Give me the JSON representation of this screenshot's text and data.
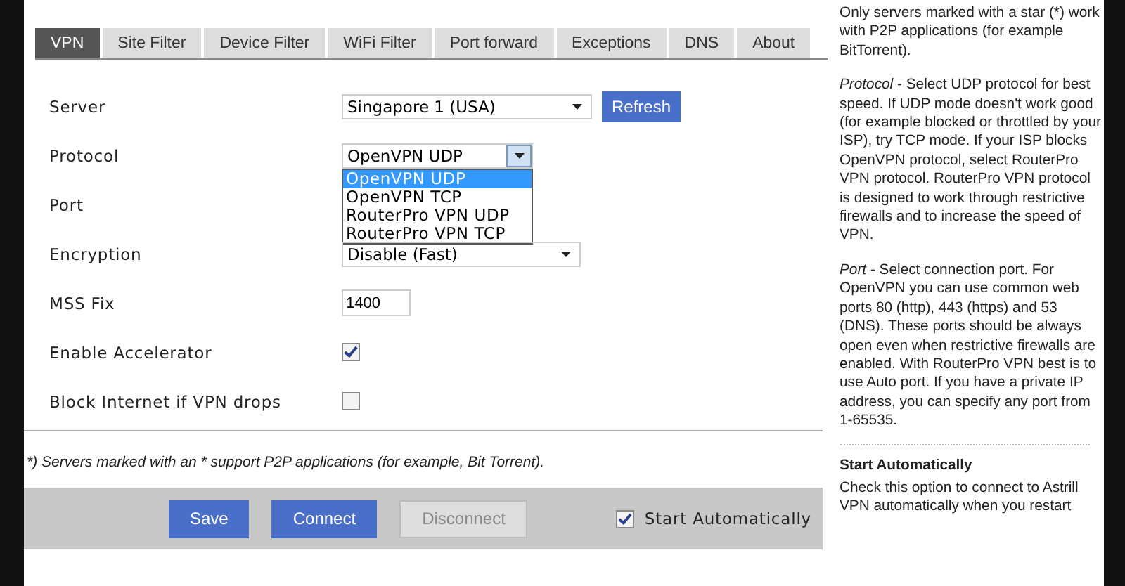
{
  "tabs": [
    {
      "label": "VPN",
      "selected": true
    },
    {
      "label": "Site Filter",
      "selected": false
    },
    {
      "label": "Device Filter",
      "selected": false
    },
    {
      "label": "WiFi Filter",
      "selected": false
    },
    {
      "label": "Port forward",
      "selected": false
    },
    {
      "label": "Exceptions",
      "selected": false
    },
    {
      "label": "DNS",
      "selected": false
    },
    {
      "label": "About",
      "selected": false
    }
  ],
  "form": {
    "rows": [
      {
        "label": "Server",
        "kind": "select",
        "value": "Singapore 1 (USA)",
        "button": "Refresh"
      },
      {
        "label": "Protocol",
        "kind": "select",
        "value": "OpenVPN UDP",
        "expanded": true,
        "options": [
          {
            "label": "OpenVPN UDP",
            "selected": true
          },
          {
            "label": "OpenVPN TCP",
            "selected": false
          },
          {
            "label": "RouterPro VPN UDP",
            "selected": false
          },
          {
            "label": "RouterPro VPN TCP",
            "selected": false
          }
        ]
      },
      {
        "label": "Port",
        "kind": "covered"
      },
      {
        "label": "Encryption",
        "kind": "select",
        "value": "Disable (Fast)"
      },
      {
        "label": "MSS Fix",
        "kind": "text",
        "value": "1400"
      },
      {
        "label": "Enable Accelerator",
        "kind": "checkbox",
        "checked": true
      },
      {
        "label": "Block Internet if VPN drops",
        "kind": "checkbox",
        "checked": false
      }
    ]
  },
  "footnote": "*) Servers marked with an * support P2P applications (for example, Bit Torrent).",
  "action_bar": {
    "buttons": [
      {
        "label": "Save",
        "disabled": false
      },
      {
        "label": "Connect",
        "disabled": false
      },
      {
        "label": "Disconnect",
        "disabled": true
      }
    ],
    "start_automatically": {
      "label": "Start Automatically",
      "checked": true
    }
  },
  "help": [
    {
      "kind": "paragraph",
      "text": "Only servers marked with a star (*) work with P2P applications (for example BitTorrent)."
    },
    {
      "kind": "paragraph",
      "text": "*Protocol* - Select UDP protocol for best speed. If UDP mode doesn't work good (for example blocked or throttled by your ISP), try TCP mode. If your ISP blocks OpenVPN protocol, select RouterPro VPN protocol. RouterPro VPN protocol is designed to work through restrictive firewalls and to increase the speed of VPN."
    },
    {
      "kind": "paragraph",
      "text": "*Port* - Select connection port. For OpenVPN you can use common web ports 80 (http), 443 (https) and 53 (DNS). These ports should be always open even when restrictive firewalls are enabled. With RouterPro VPN best is to use Auto port. If you have a private IP address, you can specify any port from 1-65535."
    },
    {
      "kind": "heading",
      "text": "Start Automatically"
    },
    {
      "kind": "paragraph",
      "text": "Check this option to connect to Astrill VPN automatically when you restart"
    }
  ]
}
